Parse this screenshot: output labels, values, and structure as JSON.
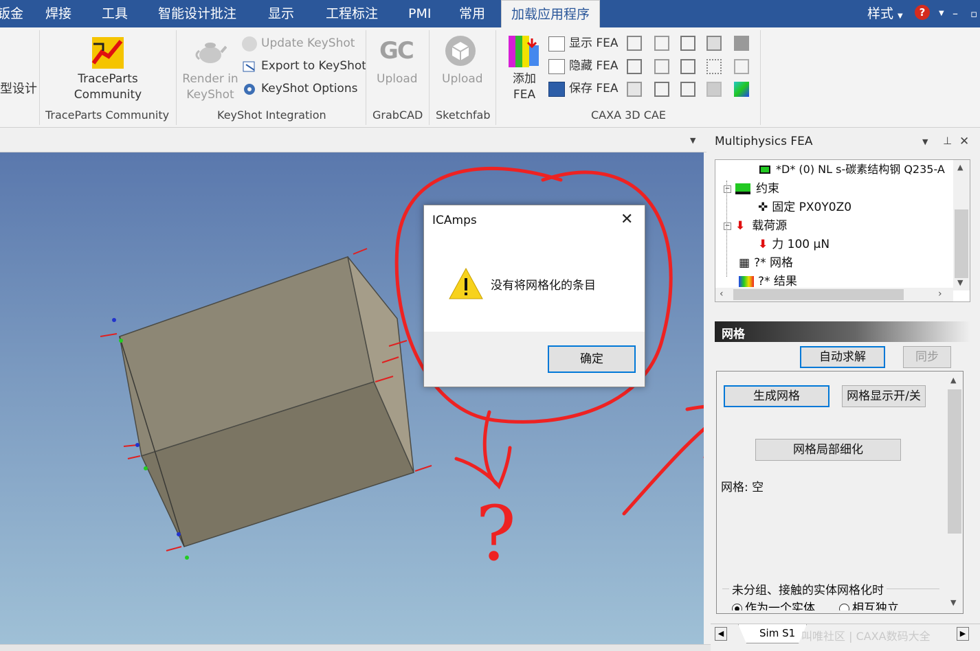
{
  "menu": {
    "tabs": [
      "钣金",
      "焊接",
      "工具",
      "智能设计批注",
      "显示",
      "工程标注",
      "PMI",
      "常用",
      "加载应用程序"
    ],
    "active_tab": "加载应用程序",
    "right": {
      "style_label": "样式",
      "help_glyph": "?"
    }
  },
  "ribbon": {
    "left_cut_label": "型设计",
    "traceparts": {
      "button": "TraceParts\nCommunity",
      "group": "TraceParts Community"
    },
    "keyshot": {
      "render": "Render in\nKeyShot",
      "update": "Update KeyShot",
      "export": "Export to KeyShot",
      "options": "KeyShot Options",
      "group": "KeyShot Integration"
    },
    "grabcad": {
      "logo": "GC",
      "upload": "Upload",
      "group": "GrabCAD"
    },
    "sketchfab": {
      "upload": "Upload",
      "group": "Sketchfab"
    },
    "caxa": {
      "add": "添加\nFEA",
      "show": "显示 FEA",
      "hide": "隐藏 FEA",
      "save": "保存 FEA",
      "group": "CAXA 3D CAE"
    }
  },
  "panel": {
    "title": "Multiphysics FEA",
    "tree": [
      {
        "label": "*D* (0)  NL s-碳素结构钢 Q235-A",
        "icon": "material-icon"
      },
      {
        "label": "约束",
        "icon": "constraint-icon"
      },
      {
        "label": "固定 PX0Y0Z0",
        "icon": "fixed-icon"
      },
      {
        "label": "载荷源",
        "icon": "load-icon"
      },
      {
        "label": "力 100 μN",
        "icon": "force-icon"
      },
      {
        "label": "?* 网格",
        "icon": "mesh-icon"
      },
      {
        "label": "?* 结果",
        "icon": "result-icon"
      }
    ],
    "section_title": "网格",
    "auto_solve": "自动求解",
    "sync": "同步",
    "gen_mesh": "生成网格",
    "mesh_toggle": "网格显示开/关",
    "local_refine": "网格局部细化",
    "mesh_status": "网格: 空",
    "group_label": "未分组、接触的实体网格化时",
    "radio_one": "作为一个实体",
    "radio_two": "相互独立",
    "sheet_tab": "Sim S1",
    "watermark": "叫唯社区 | CAXA数码大全"
  },
  "dialog": {
    "title": "ICAmps",
    "message": "没有将网格化的条目",
    "ok": "确定"
  },
  "annotation": {
    "question": "?"
  },
  "colors": {
    "accent": "#2b579a",
    "annotation": "#ee2222",
    "box_face": "#8f8877"
  }
}
